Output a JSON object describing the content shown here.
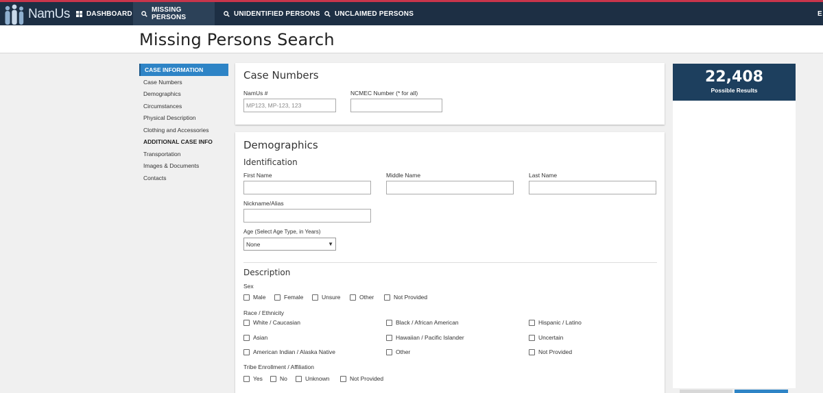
{
  "nav": {
    "logo_text": "NamUs",
    "items": [
      {
        "label": "DASHBOARD",
        "icon": "dashboard-icon"
      },
      {
        "label": "MISSING PERSONS",
        "icon": "search-icon"
      },
      {
        "label": "UNIDENTIFIED PERSONS",
        "icon": "search-icon"
      },
      {
        "label": "UNCLAIMED PERSONS",
        "icon": "search-icon"
      }
    ],
    "extra": "E",
    "colors": {
      "bar": "#1d2f44",
      "active": "#2c4158",
      "accent": "#c8354b"
    }
  },
  "page": {
    "title": "Missing Persons Search"
  },
  "sidenav": {
    "head": "CASE INFORMATION",
    "items": [
      "Case Numbers",
      "Demographics",
      "Circumstances",
      "Physical Description",
      "Clothing and Accessories"
    ],
    "section2": "ADDITIONAL CASE INFO",
    "items2": [
      "Transportation",
      "Images & Documents",
      "Contacts"
    ]
  },
  "case_numbers": {
    "title": "Case Numbers",
    "namus_label": "NamUs #",
    "namus_placeholder": "MP123, MP-123, 123",
    "ncmec_label": "NCMEC Number (* for all)"
  },
  "demographics": {
    "title": "Demographics",
    "identification": "Identification",
    "first_name": "First Name",
    "middle_name": "Middle Name",
    "last_name": "Last Name",
    "nickname": "Nickname/Alias",
    "age_label": "Age (Select Age Type, in Years)",
    "age_value": "None",
    "description": "Description",
    "sex_label": "Sex",
    "sex_options": [
      "Male",
      "Female",
      "Unsure",
      "Other",
      "Not Provided"
    ],
    "race_label": "Race / Ethnicity",
    "race_options": [
      "White / Caucasian",
      "Black / African American",
      "Hispanic / Latino",
      "Asian",
      "Hawaiian / Pacific Islander",
      "Uncertain",
      "American Indian / Alaska Native",
      "Other",
      "Not Provided"
    ],
    "tribe_label": "Tribe Enrollment / Affiliation",
    "tribe_options": [
      "Yes",
      "No",
      "Unknown",
      "Not Provided"
    ]
  },
  "results": {
    "count": "22,408",
    "label": "Possible Results",
    "color": "#1d3f5e"
  }
}
